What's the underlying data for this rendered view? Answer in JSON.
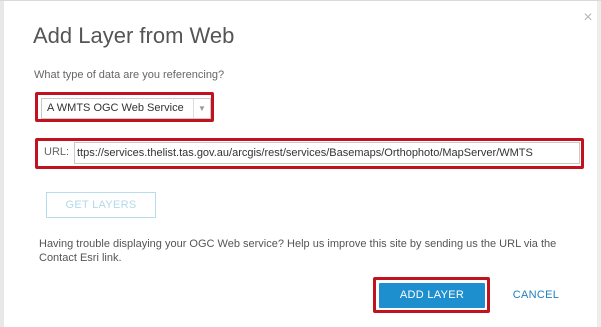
{
  "dialog": {
    "title": "Add Layer from Web",
    "close_icon": "close-icon",
    "question": "What type of data are you referencing?",
    "data_type_select": {
      "selected": "A WMTS OGC Web Service"
    },
    "url": {
      "label": "URL:",
      "value": "ttps://services.thelist.tas.gov.au/arcgis/rest/services/Basemaps/Orthophoto/MapServer/WMTS"
    },
    "get_layers_label": "GET LAYERS",
    "help_text": "Having trouble displaying your OGC Web service? Help us improve this site by sending us the URL via the Contact Esri link.",
    "add_layer_label": "ADD LAYER",
    "cancel_label": "CANCEL"
  },
  "colors": {
    "highlight": "#c1121f",
    "primary_button": "#1e8fce",
    "link": "#1e7fbf",
    "disabled_button_text": "#b3d9ea"
  }
}
